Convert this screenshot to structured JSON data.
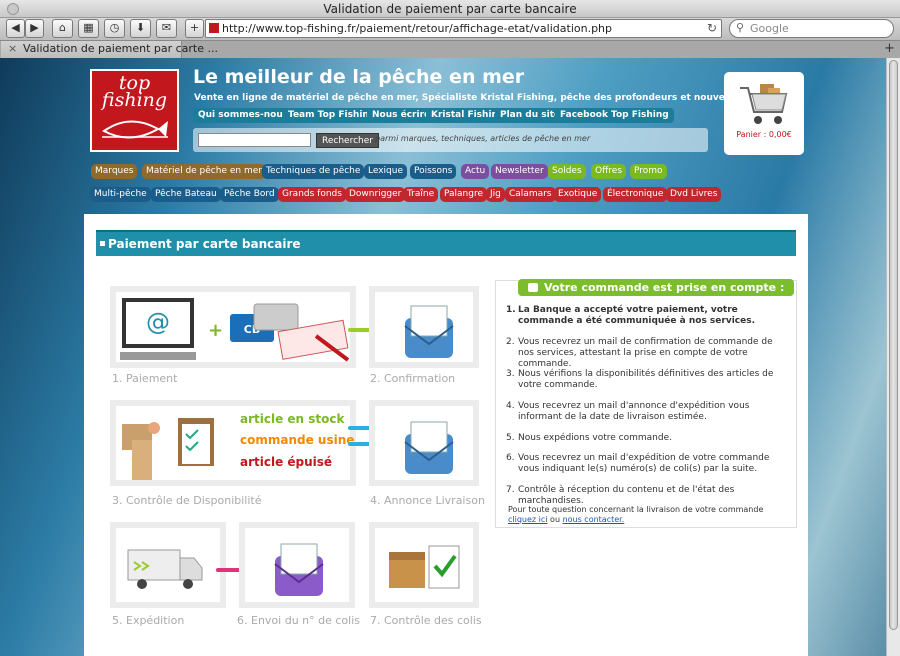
{
  "browser": {
    "title": "Validation de paiement par carte bancaire",
    "url": "http://www.top-fishing.fr/paiement/retour/affichage-etat/validation.php",
    "search_placeholder": "Google",
    "tab_label": "Validation de paiement par carte ...",
    "buttons": [
      "back",
      "forward",
      "home",
      "grid",
      "history",
      "downloads",
      "mail",
      "add"
    ]
  },
  "header": {
    "logo_line1": "top",
    "logo_line2": "fishing",
    "headline": "Le meilleur de la pêche en mer",
    "subline": "Vente en ligne de matériel de pêche en mer, Spécialiste Kristal Fishing, pêche des profondeurs et nouvelles pêches",
    "top_nav": [
      "Qui sommes-nous ?",
      "Team Top Fishing",
      "Nous écrire",
      "Kristal Fishing",
      "Plan du site",
      "Facebook Top Fishing"
    ],
    "search_button": "Rechercher",
    "search_hint": "parmi marques, techniques, articles de pêche en mer",
    "cart_label": "Panier : 0,00€"
  },
  "menu1": [
    {
      "label": "Marques",
      "color": "#8f6a2a"
    },
    {
      "label": "Matériel de pêche en mer",
      "color": "#8f6a2a"
    },
    {
      "label": "Techniques de pêche",
      "color": "#1a5d8a"
    },
    {
      "label": "Lexique",
      "color": "#1a5d8a"
    },
    {
      "label": "Poissons",
      "color": "#1a5d8a"
    },
    {
      "label": "Actu",
      "color": "#7a4fa0"
    },
    {
      "label": "Newsletter",
      "color": "#7a4fa0"
    },
    {
      "label": "Soldes",
      "color": "#7cb820"
    },
    {
      "label": "Offres",
      "color": "#7cb820"
    },
    {
      "label": "Promo",
      "color": "#7cb820"
    }
  ],
  "menu2": [
    {
      "label": "Multi-pêche",
      "color": "#1a5d8a"
    },
    {
      "label": "Pêche Bateau",
      "color": "#1a5d8a"
    },
    {
      "label": "Pêche Bord",
      "color": "#1a5d8a"
    },
    {
      "label": "Grands fonds",
      "color": "#c0282e"
    },
    {
      "label": "Downrigger",
      "color": "#c0282e"
    },
    {
      "label": "Traîne",
      "color": "#c0282e"
    },
    {
      "label": "Palangre",
      "color": "#c0282e"
    },
    {
      "label": "Jig",
      "color": "#c0282e"
    },
    {
      "label": "Calamars",
      "color": "#c0282e"
    },
    {
      "label": "Exotique",
      "color": "#c0282e"
    },
    {
      "label": "Électronique",
      "color": "#c0282e"
    },
    {
      "label": "Dvd Livres",
      "color": "#c0282e"
    }
  ],
  "section_title": "Paiement par carte bancaire",
  "steps": [
    {
      "caption": "1. Paiement"
    },
    {
      "caption": "2. Confirmation"
    },
    {
      "caption": "3. Contrôle de Disponibilité"
    },
    {
      "caption": "4. Annonce Livraison"
    },
    {
      "caption": "5. Expédition"
    },
    {
      "caption": "6. Envoi du n° de colis"
    },
    {
      "caption": "7. Contrôle des colis"
    }
  ],
  "availability": {
    "in_stock": "article en stock",
    "factory": "commande usine",
    "sold_out": "article épuisé"
  },
  "info": {
    "title": "Votre commande est prise en compte :",
    "items": [
      "La Banque a accepté votre paiement, votre commande a été communiquée à nos services.",
      "Vous recevrez un mail de confirmation de commande de nos services, attestant la prise en compte de votre commande.",
      "Nous vérifions la disponibilités définitives des articles de votre commande.",
      "Vous recevrez un mail d'annonce d'expédition vous informant de la date de livraison estimée.",
      "Nous expédions votre commande.",
      "Vous recevrez un mail d'expédition de votre commande vous indiquant le(s) numéro(s) de coli(s) par la suite.",
      "Contrôle à réception du contenu et de l'état des marchandises."
    ],
    "note": "Pour toute question concernant la livraison de votre commande",
    "link1": "cliquez ici",
    "link_sep": "ou",
    "link2": "nous contacter."
  },
  "colors": {
    "teal": "#1f8faa",
    "green": "#7cbd2d",
    "red": "#c2171d",
    "arrow_green": "#9ccc2a",
    "arrow_blue": "#2ab0e0",
    "arrow_pink": "#e0337a"
  }
}
